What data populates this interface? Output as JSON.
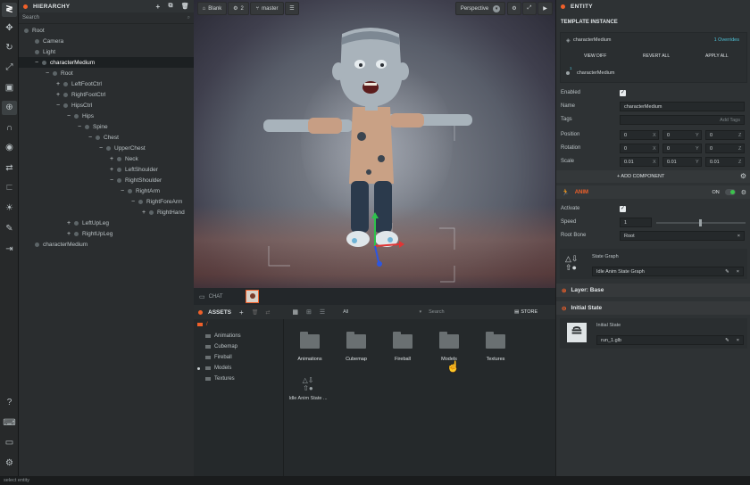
{
  "hierarchy": {
    "title": "HIERARCHY",
    "search_placeholder": "Search",
    "rows": [
      {
        "label": "Root",
        "depth": 0,
        "ex": ""
      },
      {
        "label": "Camera",
        "depth": 1,
        "ex": ""
      },
      {
        "label": "Light",
        "depth": 1,
        "ex": ""
      },
      {
        "label": "characterMedium",
        "depth": 1,
        "ex": "−"
      },
      {
        "label": "Root",
        "depth": 2,
        "ex": "−"
      },
      {
        "label": "LeftFootCtrl",
        "depth": 3,
        "ex": "+"
      },
      {
        "label": "RightFootCtrl",
        "depth": 3,
        "ex": "+"
      },
      {
        "label": "HipsCtrl",
        "depth": 3,
        "ex": "−"
      },
      {
        "label": "Hips",
        "depth": 4,
        "ex": "−"
      },
      {
        "label": "Spine",
        "depth": 5,
        "ex": "−"
      },
      {
        "label": "Chest",
        "depth": 6,
        "ex": "−"
      },
      {
        "label": "UpperChest",
        "depth": 7,
        "ex": "−"
      },
      {
        "label": "Neck",
        "depth": 8,
        "ex": "+"
      },
      {
        "label": "LeftShoulder",
        "depth": 8,
        "ex": "+"
      },
      {
        "label": "RightShoulder",
        "depth": 8,
        "ex": "−"
      },
      {
        "label": "RightArm",
        "depth": 9,
        "ex": "−"
      },
      {
        "label": "RightForeArm",
        "depth": 10,
        "ex": "−"
      },
      {
        "label": "RightHand",
        "depth": 11,
        "ex": "+"
      },
      {
        "label": "LeftUpLeg",
        "depth": 4,
        "ex": "+"
      },
      {
        "label": "RightUpLeg",
        "depth": 4,
        "ex": "+"
      },
      {
        "label": "characterMedium",
        "depth": 1,
        "ex": ""
      }
    ]
  },
  "viewport": {
    "scene": "Blank",
    "users": "2",
    "branch": "master",
    "camera": "Perspective",
    "chat_label": "CHAT"
  },
  "assets": {
    "title": "ASSETS",
    "filter": "All",
    "search_placeholder": "Search",
    "store": "STORE",
    "tree_root": "/",
    "folders_tree": [
      "Animations",
      "Cubemap",
      "Fireball",
      "Models",
      "Textures"
    ],
    "grid_items": [
      "Animations",
      "Cubemap",
      "Fireball",
      "Models",
      "Textures"
    ],
    "anim_item": "Idle Anim State ..."
  },
  "entity": {
    "title": "ENTITY",
    "template_header": "TEMPLATE INSTANCE",
    "template_name": "characterMedium",
    "overrides": "1 Overrides",
    "view_diff": "VIEW DIFF",
    "revert_all": "REVERT ALL",
    "apply_all": "APPLY ALL",
    "instance_badge": "1",
    "instance_name": "characterMedium",
    "enabled_label": "Enabled",
    "name_label": "Name",
    "name_value": "characterMedium",
    "tags_label": "Tags",
    "tags_placeholder": "Add Tags",
    "position_label": "Position",
    "position": [
      "0",
      "0",
      "0"
    ],
    "rotation_label": "Rotation",
    "rotation": [
      "0",
      "0",
      "0"
    ],
    "scale_label": "Scale",
    "scale": [
      "0.01",
      "0.01",
      "0.01"
    ],
    "add_component": "+ ADD COMPONENT",
    "axes": [
      "X",
      "Y",
      "Z"
    ]
  },
  "anim": {
    "title": "ANIM",
    "state": "ON",
    "activate_label": "Activate",
    "speed_label": "Speed",
    "speed_value": "1",
    "root_bone_label": "Root Bone",
    "root_bone_value": "Root",
    "state_graph_label": "State Graph",
    "state_graph_value": "Idle Anim State Graph",
    "layer_label": "Layer: Base",
    "initial_state_header": "Initial State",
    "initial_state_label": "Initial State",
    "initial_state_value": "run_1.glb"
  },
  "status_bar": "select entity",
  "colors": {
    "accent": "#f0602a",
    "bg_dark": "#1f2324",
    "panel": "#2a2d2f"
  }
}
